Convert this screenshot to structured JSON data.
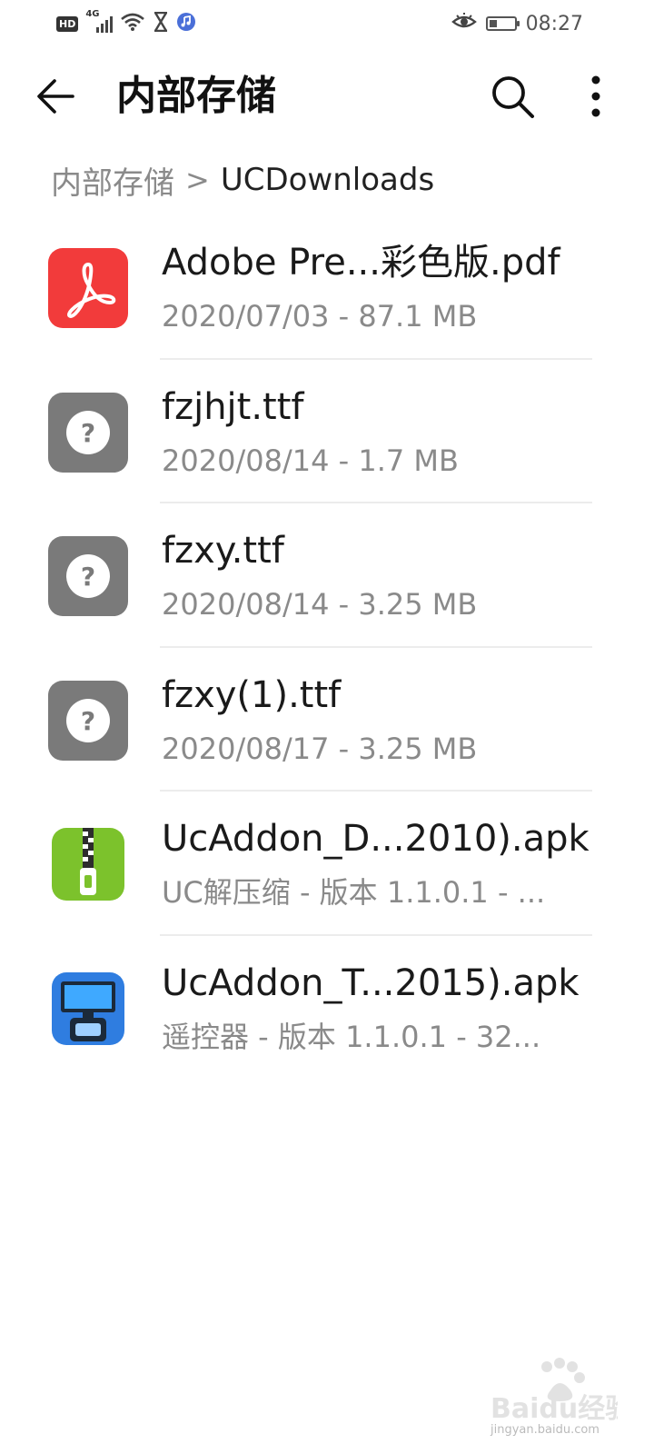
{
  "status_bar": {
    "hd_label": "HD",
    "network_label": "4G",
    "time": "08:27"
  },
  "header": {
    "title": "内部存储"
  },
  "breadcrumb": {
    "root": "内部存储",
    "separator": ">",
    "current": "UCDownloads"
  },
  "files": [
    {
      "name": "Adobe Pre...彩色版.pdf",
      "meta": "2020/07/03 - 87.1 MB",
      "icon": "pdf-icon"
    },
    {
      "name": "fzjhjt.ttf",
      "meta": "2020/08/14 - 1.7 MB",
      "icon": "unknown-file-icon"
    },
    {
      "name": "fzxy.ttf",
      "meta": "2020/08/14 - 3.25 MB",
      "icon": "unknown-file-icon"
    },
    {
      "name": "fzxy(1).ttf",
      "meta": "2020/08/17 - 3.25 MB",
      "icon": "unknown-file-icon"
    },
    {
      "name": "UcAddon_D...2010).apk",
      "meta": "UC解压缩 - 版本 1.1.0.1 - ...",
      "icon": "zip-app-icon"
    },
    {
      "name": "UcAddon_T...2015).apk",
      "meta": "遥控器 - 版本 1.1.0.1 - 32...",
      "icon": "remote-app-icon"
    }
  ],
  "watermark": {
    "brand": "Baidu经验",
    "caption": "jingyan.baidu.com"
  },
  "colors": {
    "pdf_red": "#f23b3b",
    "unknown_gray": "#7a7a7a",
    "zip_green": "#7cc22c",
    "remote_blue": "#2f7de0"
  }
}
